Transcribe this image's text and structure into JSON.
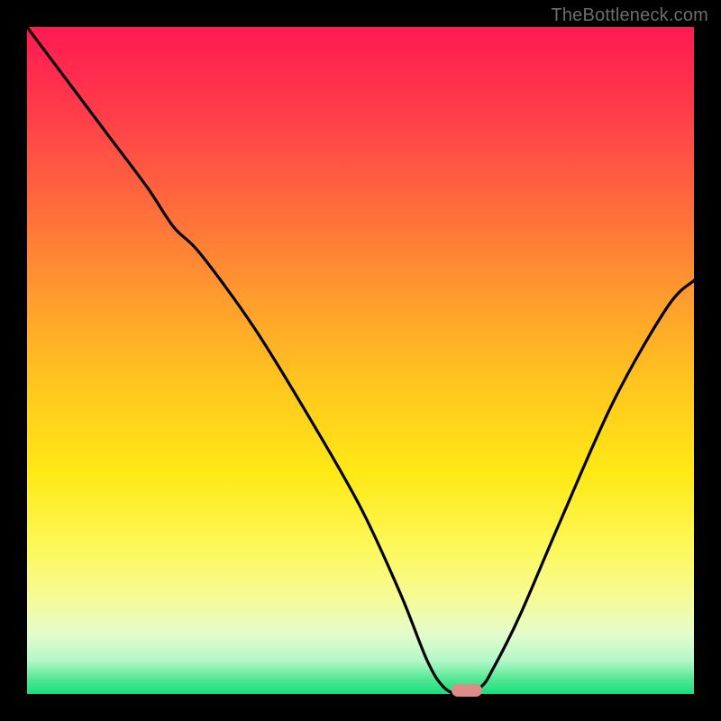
{
  "watermark": {
    "text": "TheBottleneck.com"
  },
  "colors": {
    "frame": "#000000",
    "marker": "#e08a8a",
    "curve": "#000000",
    "gradient_top": "#ff1952",
    "gradient_bottom": "#17de80"
  },
  "chart_data": {
    "type": "line",
    "title": "",
    "xlabel": "",
    "ylabel": "",
    "xlim": [
      0,
      100
    ],
    "ylim": [
      0,
      100
    ],
    "grid": false,
    "legend": false,
    "description": "Bottleneck curve with a V-shaped minimum. Y represents bottleneck percentage (100 = severe, 0 = none). The optimal point lies at the valley floor.",
    "series": [
      {
        "name": "bottleneck_curve",
        "x": [
          0,
          6,
          12,
          18,
          22,
          26,
          34,
          42,
          50,
          56,
          60,
          62.5,
          65,
          68,
          70,
          74,
          80,
          88,
          96,
          100
        ],
        "y": [
          100,
          92,
          84,
          76,
          70,
          66,
          55,
          42,
          28,
          15,
          5,
          1,
          0,
          1,
          4,
          12,
          26,
          44,
          58,
          62
        ]
      }
    ],
    "optimal_marker": {
      "x": 66,
      "y": 0.5
    }
  }
}
